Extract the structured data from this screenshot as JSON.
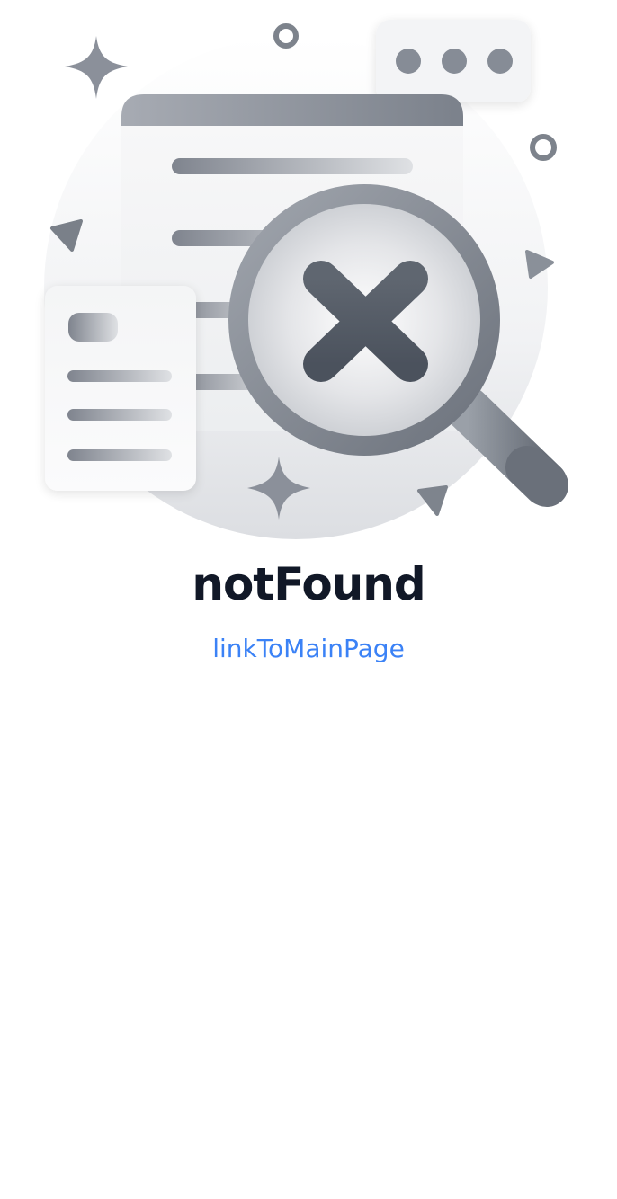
{
  "not_found": {
    "title": "notFound",
    "link_label": "linkToMainPage",
    "illustration_icon": "magnifier-with-x-icon"
  },
  "colors": {
    "title": "#111827",
    "link": "#3b82f6",
    "illustration_dark": "#5f6673",
    "illustration_mid": "#8b919c",
    "illustration_light": "#e5e7eb"
  }
}
